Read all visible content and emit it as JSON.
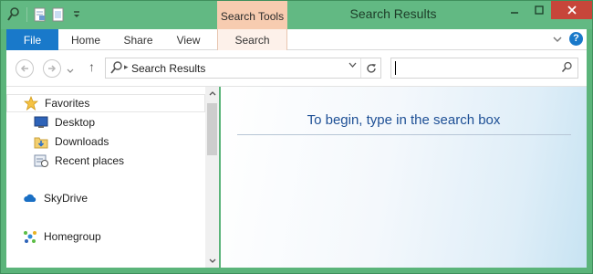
{
  "window": {
    "title": "Search Results",
    "context_tab_group": "Search Tools",
    "buttons": {
      "minimize": "–",
      "maximize": "☐",
      "close": "✕"
    }
  },
  "ribbon": {
    "tabs": [
      {
        "label": "File"
      },
      {
        "label": "Home"
      },
      {
        "label": "Share"
      },
      {
        "label": "View"
      },
      {
        "label": "Search"
      }
    ],
    "expand_icon": "chevron-down-icon",
    "help_label": "?"
  },
  "navigation": {
    "back_icon": "back-arrow-icon",
    "forward_icon": "forward-arrow-icon",
    "up_label": "↑",
    "address": {
      "separator": "▸",
      "location": "Search Results"
    },
    "search": {
      "value": "",
      "placeholder": ""
    }
  },
  "nav_pane": {
    "items": [
      {
        "label": "Favorites",
        "icon": "star-icon"
      },
      {
        "label": "Desktop",
        "icon": "desktop-icon"
      },
      {
        "label": "Downloads",
        "icon": "downloads-folder-icon"
      },
      {
        "label": "Recent places",
        "icon": "recent-places-icon"
      },
      {
        "label": "SkyDrive",
        "icon": "cloud-icon"
      },
      {
        "label": "Homegroup",
        "icon": "homegroup-icon"
      }
    ]
  },
  "content": {
    "message": "To begin, type in the search box"
  },
  "colors": {
    "titlebar": "#62b983",
    "file_tab": "#1979ca",
    "context_tab": "#f7ccb0",
    "close_button": "#c7463a",
    "message_text": "#1d4f95"
  }
}
